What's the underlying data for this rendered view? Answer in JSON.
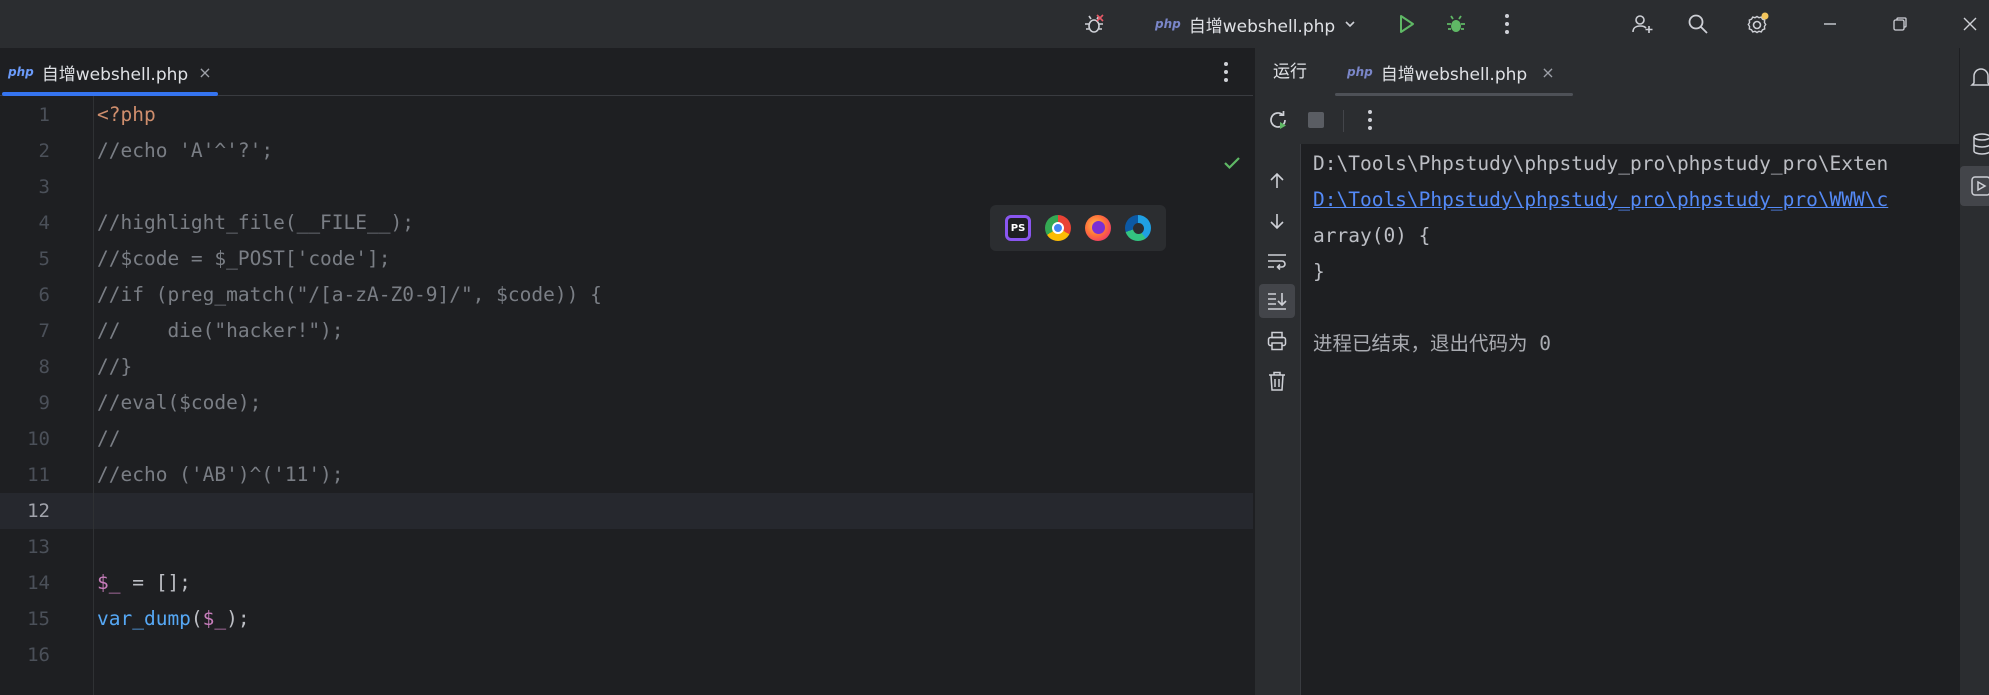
{
  "titlebar": {
    "run_config_badge": "php",
    "run_config_name": "自增webshell.php",
    "icons": [
      "bug-icon",
      "run-icon",
      "debug-icon",
      "more-vertical-icon",
      "add-user-icon",
      "search-icon",
      "settings-icon",
      "minimize-icon",
      "restore-icon",
      "close-icon"
    ]
  },
  "editor": {
    "tab": {
      "badge": "php",
      "name": "自增webshell.php",
      "close": "×"
    },
    "current_line": 12,
    "lines": [
      {
        "n": "1",
        "segments": [
          {
            "t": "<?php",
            "k": "tag"
          }
        ]
      },
      {
        "n": "2",
        "segments": [
          {
            "t": "//echo 'A'^'?';",
            "k": "comment"
          }
        ]
      },
      {
        "n": "3",
        "segments": []
      },
      {
        "n": "4",
        "segments": [
          {
            "t": "//highlight_file(__FILE__);",
            "k": "comment"
          }
        ]
      },
      {
        "n": "5",
        "segments": [
          {
            "t": "//$code = $_POST['code'];",
            "k": "comment"
          }
        ]
      },
      {
        "n": "6",
        "segments": [
          {
            "t": "//if (preg_match(\"/[a-zA-Z0-9]/\", $code)) {",
            "k": "comment"
          }
        ]
      },
      {
        "n": "7",
        "segments": [
          {
            "t": "//    die(\"hacker!\");",
            "k": "comment"
          }
        ]
      },
      {
        "n": "8",
        "segments": [
          {
            "t": "//}",
            "k": "comment"
          }
        ]
      },
      {
        "n": "9",
        "segments": [
          {
            "t": "//eval($code);",
            "k": "comment"
          }
        ]
      },
      {
        "n": "10",
        "segments": [
          {
            "t": "//",
            "k": "comment"
          }
        ]
      },
      {
        "n": "11",
        "segments": [
          {
            "t": "//echo ('AB')^('11');",
            "k": "comment"
          }
        ]
      },
      {
        "n": "12",
        "segments": []
      },
      {
        "n": "13",
        "segments": []
      },
      {
        "n": "14",
        "segments": [
          {
            "t": "$_",
            "k": "var"
          },
          {
            "t": " = [];",
            "k": "plain"
          }
        ]
      },
      {
        "n": "15",
        "segments": [
          {
            "t": "var_dump",
            "k": "fn"
          },
          {
            "t": "(",
            "k": "plain"
          },
          {
            "t": "$_",
            "k": "var"
          },
          {
            "t": ");",
            "k": "plain"
          }
        ]
      },
      {
        "n": "16",
        "segments": []
      }
    ],
    "browser_icons": [
      "phpstorm-icon",
      "chrome-icon",
      "firefox-icon",
      "edge-icon"
    ],
    "ps_label": "PS"
  },
  "run_panel": {
    "title": "运行",
    "tab": {
      "badge": "php",
      "name": "自增webshell.php",
      "close": "×"
    },
    "console_lines": [
      {
        "text": "D:\\Tools\\Phpstudy\\phpstudy_pro\\phpstudy_pro\\Exten",
        "kind": "plain"
      },
      {
        "text": "D:\\Tools\\Phpstudy\\phpstudy_pro\\phpstudy_pro\\WWW\\c",
        "kind": "link"
      },
      {
        "text": "array(0) {",
        "kind": "plain"
      },
      {
        "text": "}",
        "kind": "plain"
      },
      {
        "text": "",
        "kind": "plain"
      },
      {
        "text": "进程已结束，退出代码为 0",
        "kind": "exit"
      }
    ]
  },
  "colors": {
    "accent": "#3574f0",
    "run_green": "#5fb865",
    "link": "#548af7",
    "settings_badge": "#f2c55c"
  }
}
